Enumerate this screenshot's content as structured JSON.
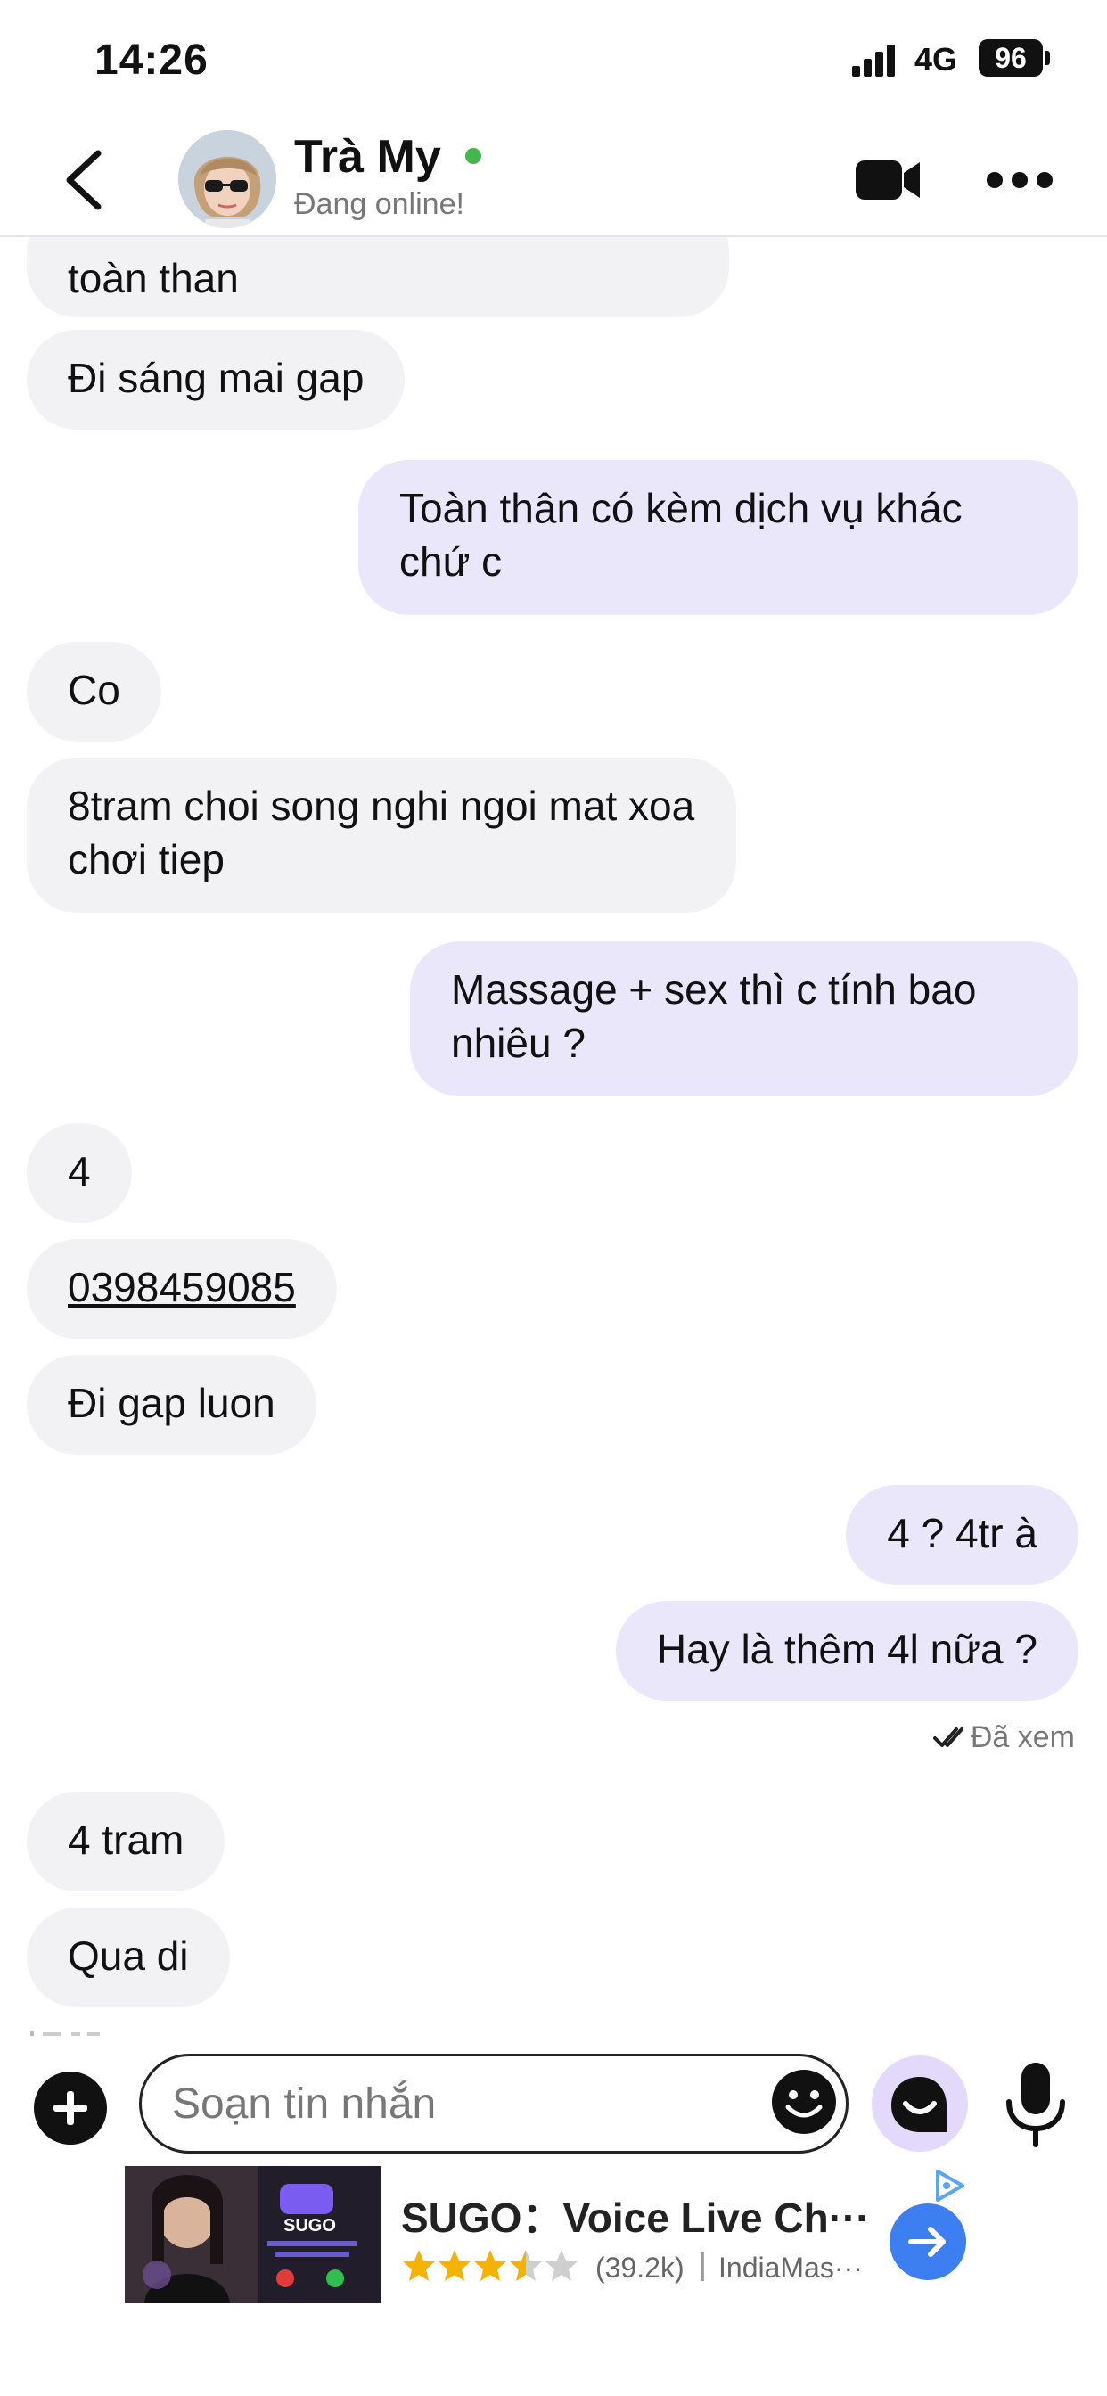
{
  "status_bar": {
    "time": "14:26",
    "network": "4G",
    "battery": "96"
  },
  "header": {
    "contact_name": "Trà My",
    "contact_status": "Đang online!",
    "online": true
  },
  "messages": [
    {
      "side": "in",
      "text": "toàn than"
    },
    {
      "side": "in",
      "text": "Đi sáng mai gap"
    },
    {
      "side": "out",
      "text": "Toàn thân có kèm dịch vụ khác chứ c"
    },
    {
      "side": "in",
      "text": "Co"
    },
    {
      "side": "in",
      "text": "8tram choi song nghi ngoi mat xoa chơi tiep"
    },
    {
      "side": "out",
      "text": "Massage + sex thì c tính bao nhiêu ?"
    },
    {
      "side": "in",
      "text": "4"
    },
    {
      "side": "in",
      "text": "0398459085",
      "is_phone": true
    },
    {
      "side": "in",
      "text": "Đi gap luon"
    },
    {
      "side": "out",
      "text": "4 ? 4tr à"
    },
    {
      "side": "out",
      "text": "Hay là thêm 4l nữa ?"
    },
    {
      "side": "in",
      "text": "4 tram"
    },
    {
      "side": "in",
      "text": "Qua di"
    }
  ],
  "seen_status": "Đã xem",
  "composer": {
    "placeholder": "Soạn tin nhắn"
  },
  "ad": {
    "title": "SUGO：Voice Live Ch···",
    "rating_stars": 3.5,
    "rating_count": "(39.2k)",
    "developer": "IndiaMas···",
    "thumb_label": "SUGO"
  },
  "colors": {
    "incoming_bubble": "#f2f2f5",
    "outgoing_bubble": "#ebe7fa",
    "online": "#45b649",
    "ad_button": "#3d7ff0",
    "star": "#f5b301"
  }
}
